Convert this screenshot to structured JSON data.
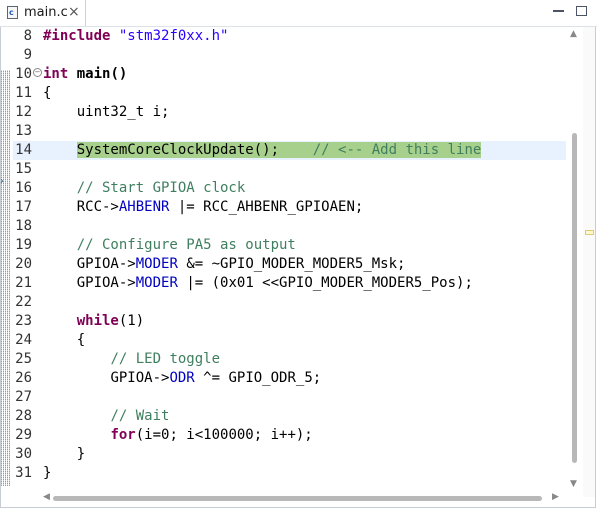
{
  "tab": {
    "label": "main.c",
    "icon": "c-file-icon",
    "icon_letter": "c",
    "close": "×"
  },
  "window": {
    "minimize": "minimize-icon",
    "maximize": "maximize-icon"
  },
  "editor": {
    "lines": [
      {
        "n": "8"
      },
      {
        "n": "9"
      },
      {
        "n": "10"
      },
      {
        "n": "11"
      },
      {
        "n": "12"
      },
      {
        "n": "13"
      },
      {
        "n": "14"
      },
      {
        "n": "15"
      },
      {
        "n": "16"
      },
      {
        "n": "17"
      },
      {
        "n": "18"
      },
      {
        "n": "19"
      },
      {
        "n": "20"
      },
      {
        "n": "21"
      },
      {
        "n": "22"
      },
      {
        "n": "23"
      },
      {
        "n": "24"
      },
      {
        "n": "25"
      },
      {
        "n": "26"
      },
      {
        "n": "27"
      },
      {
        "n": "28"
      },
      {
        "n": "29"
      },
      {
        "n": "30"
      },
      {
        "n": "31"
      }
    ],
    "tokens": {
      "l8_inc": "#include",
      "l8_str": "\"stm32f0xx.h\"",
      "l10_kw": "int",
      "l10_rest": "main()",
      "l11": "{",
      "l12": "uint32_t i;",
      "l14_code": "SystemCoreClockUpdate();",
      "l14_comment": "// <-- Add this line",
      "l16": "// Start GPIOA clock",
      "l17_a": "RCC->",
      "l17_f": "AHBENR",
      "l17_b": " |= RCC_AHBENR_GPIOAEN;",
      "l19": "// Configure PA5 as output",
      "l20_a": "GPIOA->",
      "l20_f": "MODER",
      "l20_b": " &= ~GPIO_MODER_MODER5_Msk;",
      "l21_a": "GPIOA->",
      "l21_f": "MODER",
      "l21_b": " |= (0x01 <<GPIO_MODER_MODER5_Pos);",
      "l23_kw": "while",
      "l23_rest": "(1)",
      "l24": "{",
      "l25": "// LED toggle",
      "l26_a": "GPIOA->",
      "l26_f": "ODR",
      "l26_b": " ^= GPIO_ODR_5;",
      "l28": "// Wait",
      "l29_kw": "for",
      "l29_rest": "(i=0; i<100000; i++);",
      "l30": "}",
      "l31": "}"
    },
    "current_line": "14"
  },
  "scroll": {
    "up": "▲",
    "down": "▼",
    "left": "◀",
    "right": "▶"
  },
  "colors": {
    "highlight": "#a8d08d",
    "current_line": "#e8f2fe",
    "keyword": "#7f0055",
    "string": "#2a00ff",
    "comment": "#3f7f5f",
    "field": "#0000c0"
  }
}
